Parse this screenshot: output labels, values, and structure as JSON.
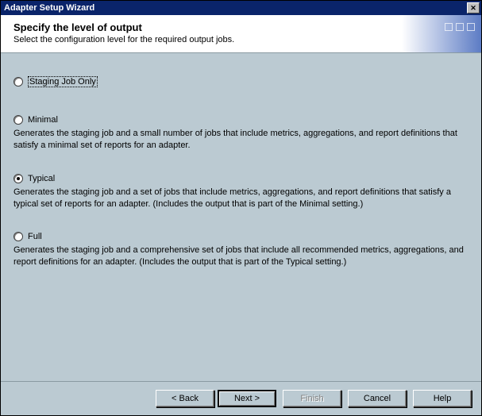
{
  "window_title": "Adapter Setup Wizard",
  "header": {
    "title": "Specify the level of output",
    "subtitle": "Select the configuration level for the required output jobs."
  },
  "options": {
    "staging": {
      "label": "Staging Job Only",
      "selected": false,
      "focused": true
    },
    "minimal": {
      "label": "Minimal",
      "selected": false,
      "desc": "Generates the staging job and a small number of jobs that include metrics, aggregations, and report definitions that satisfy a minimal set of reports for an adapter."
    },
    "typical": {
      "label": "Typical",
      "selected": true,
      "desc": "Generates the staging job and a set of jobs that include metrics, aggregations, and report definitions that satisfy a typical set of reports for an adapter. (Includes the output that is part of the Minimal setting.)"
    },
    "full": {
      "label": "Full",
      "selected": false,
      "desc": "Generates the staging job and a comprehensive set of jobs that include all recommended metrics, aggregations, and report definitions for an adapter. (Includes the output that is part of the Typical setting.)"
    }
  },
  "buttons": {
    "back": "< Back",
    "next": "Next >",
    "finish": "Finish",
    "cancel": "Cancel",
    "help": "Help"
  }
}
